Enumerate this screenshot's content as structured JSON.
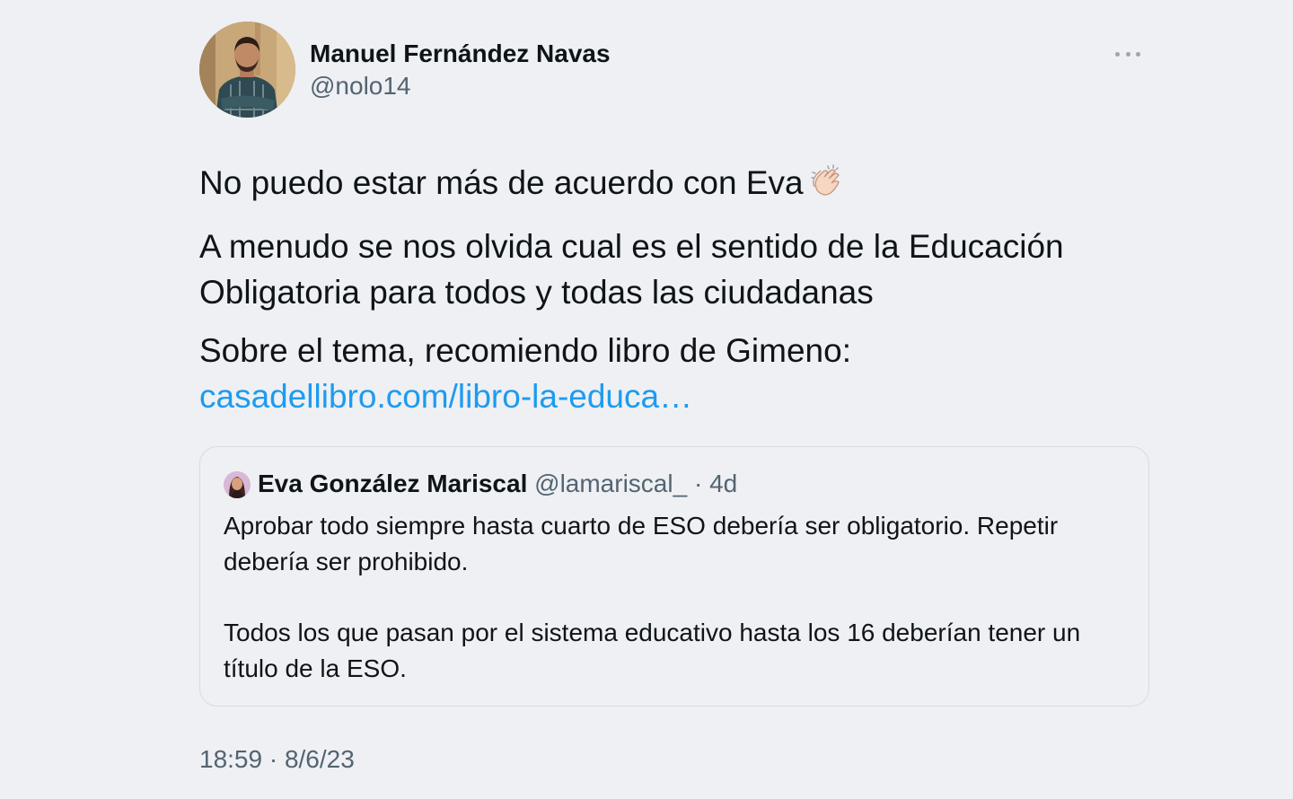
{
  "author": {
    "name": "Manuel Fernández Navas",
    "handle": "@nolo14"
  },
  "icons": {
    "more": "more-horizontal-icon",
    "emoji": "clapping-hands-icon"
  },
  "tweet": {
    "line1": "No puedo estar más de acuerdo con Eva",
    "paragraph2": "A menudo se nos olvida cual es el sentido de la Educación Obligatoria para todos y todas las ciudadanas",
    "paragraph3": "Sobre el tema, recomiendo libro de Gimeno:",
    "link_text": "casadellibro.com/libro-la-educa…",
    "timestamp": "18:59 · 8/6/23"
  },
  "quoted": {
    "name": "Eva González Mariscal",
    "handle": "@lamariscal_",
    "separator": "·",
    "time": "4d",
    "paragraph1": "Aprobar todo siempre hasta cuarto de ESO debería ser obligatorio. Repetir debería ser prohibido.",
    "paragraph2": "Todos los que pasan por el sistema educativo hasta los 16 deberían tener un título de la ESO."
  },
  "colors": {
    "background": "#eef0f3",
    "text": "#0f1419",
    "secondary": "#536471",
    "link": "#1d9bf0",
    "border": "#d6dce2"
  }
}
